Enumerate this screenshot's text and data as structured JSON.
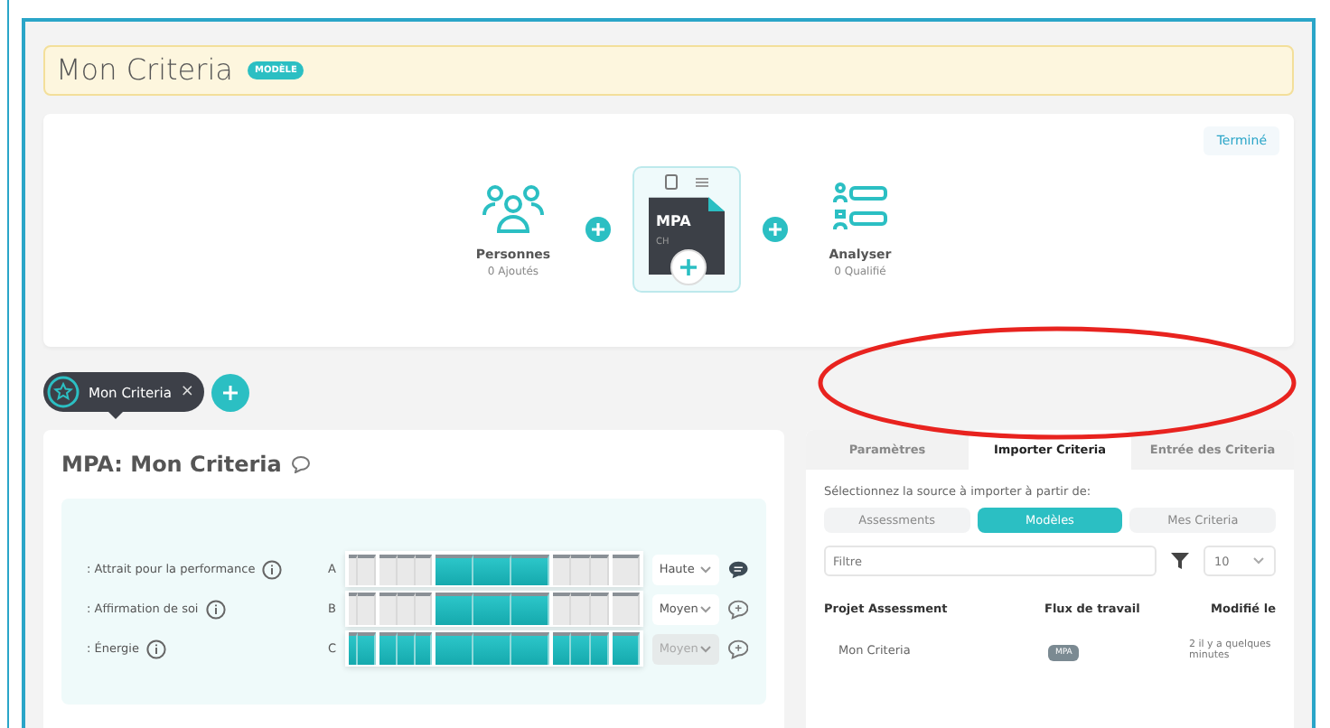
{
  "header": {
    "title": "Mon Criteria",
    "badge": "MODÈLE"
  },
  "done_button": "Terminé",
  "flow": {
    "people": {
      "label": "Personnes",
      "sub": "0 Ajoutés"
    },
    "doc": {
      "title": "MPA",
      "sub": "CH"
    },
    "analyse": {
      "label": "Analyser",
      "sub": "0 Qualifié"
    }
  },
  "chip": {
    "label": "Mon Criteria",
    "close": "×"
  },
  "left_card": {
    "title": "MPA: Mon Criteria",
    "rows": [
      {
        "label": ": Attrait pour la performance",
        "letter": "A",
        "value": "Haute",
        "disabled": false,
        "comment_filled": true,
        "cells": [
          false,
          false,
          false,
          false,
          false,
          true,
          true,
          true,
          false,
          false,
          false,
          false
        ]
      },
      {
        "label": ": Affirmation de soi",
        "letter": "B",
        "value": "Moyen",
        "disabled": false,
        "comment_filled": false,
        "cells": [
          false,
          false,
          false,
          false,
          false,
          true,
          true,
          true,
          false,
          false,
          false,
          false
        ]
      },
      {
        "label": ": Énergie",
        "letter": "C",
        "value": "Moyen",
        "disabled": true,
        "comment_filled": false,
        "cells": [
          true,
          true,
          true,
          true,
          true,
          true,
          true,
          true,
          true,
          true,
          true,
          true
        ]
      }
    ]
  },
  "right_card": {
    "tabs": [
      {
        "label": "Paramètres",
        "selected": false
      },
      {
        "label": "Importer Criteria",
        "selected": true
      },
      {
        "label": "Entrée des Criteria",
        "selected": false
      }
    ],
    "prompt": "Sélectionnez la source à importer à partir de:",
    "sources": [
      {
        "label": "Assessments",
        "selected": false
      },
      {
        "label": "Modèles",
        "selected": true
      },
      {
        "label": "Mes Criteria",
        "selected": false
      }
    ],
    "filter": {
      "placeholder": "Filtre"
    },
    "page_size": "10",
    "columns": [
      "Projet Assessment",
      "Flux de travail",
      "Modifié le"
    ],
    "rows": [
      {
        "name": "Mon Criteria",
        "workflow": "MPA",
        "modified": "2 il y a quelques minutes"
      }
    ]
  }
}
